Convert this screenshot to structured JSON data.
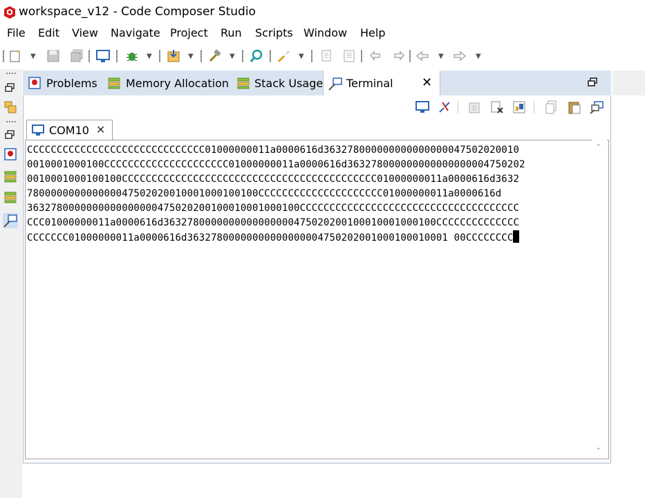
{
  "window": {
    "title": "workspace_v12 - Code Composer Studio"
  },
  "menu": [
    "File",
    "Edit",
    "View",
    "Navigate",
    "Project",
    "Run",
    "Scripts",
    "Window",
    "Help"
  ],
  "tabs": {
    "problems": "Problems",
    "memory": "Memory Allocation",
    "stack": "Stack Usage",
    "terminal": "Terminal"
  },
  "terminal_tab": {
    "label": "COM10"
  },
  "terminal": {
    "lines": [
      "CCCCCCCCCCCCCCCCCCCCCCCCCCCCCC01000000011a0000616d363278000000000000000047502020010",
      "0010001000100CCCCCCCCCCCCCCCCCCCCC01000000011a0000616d363278000000000000000004750202",
      "0010001000100100CCCCCCCCCCCCCCCCCCCCCCCCCCCCCCCCCCCCCCCCCCC01000000011a0000616d3632",
      "780000000000000047502020010001000100100CCCCCCCCCCCCCCCCCCCCC01000000011a0000616d",
      "3632780000000000000000475020200100010001000100CCCCCCCCCCCCCCCCCCCCCCCCCCCCCCCCCCCCC",
      "CCC01000000011a0000616d3632780000000000000000475020200100010001000100CCCCCCCCCCCCCC",
      "CCCCCCC01000000011a0000616d36327800000000000000004750202001000100010001 00CCCCCCCC"
    ]
  },
  "colors": {
    "tab_bar": "#dae4f0",
    "accent_blue": "#2f65b6",
    "logo_red": "#d4191f"
  }
}
